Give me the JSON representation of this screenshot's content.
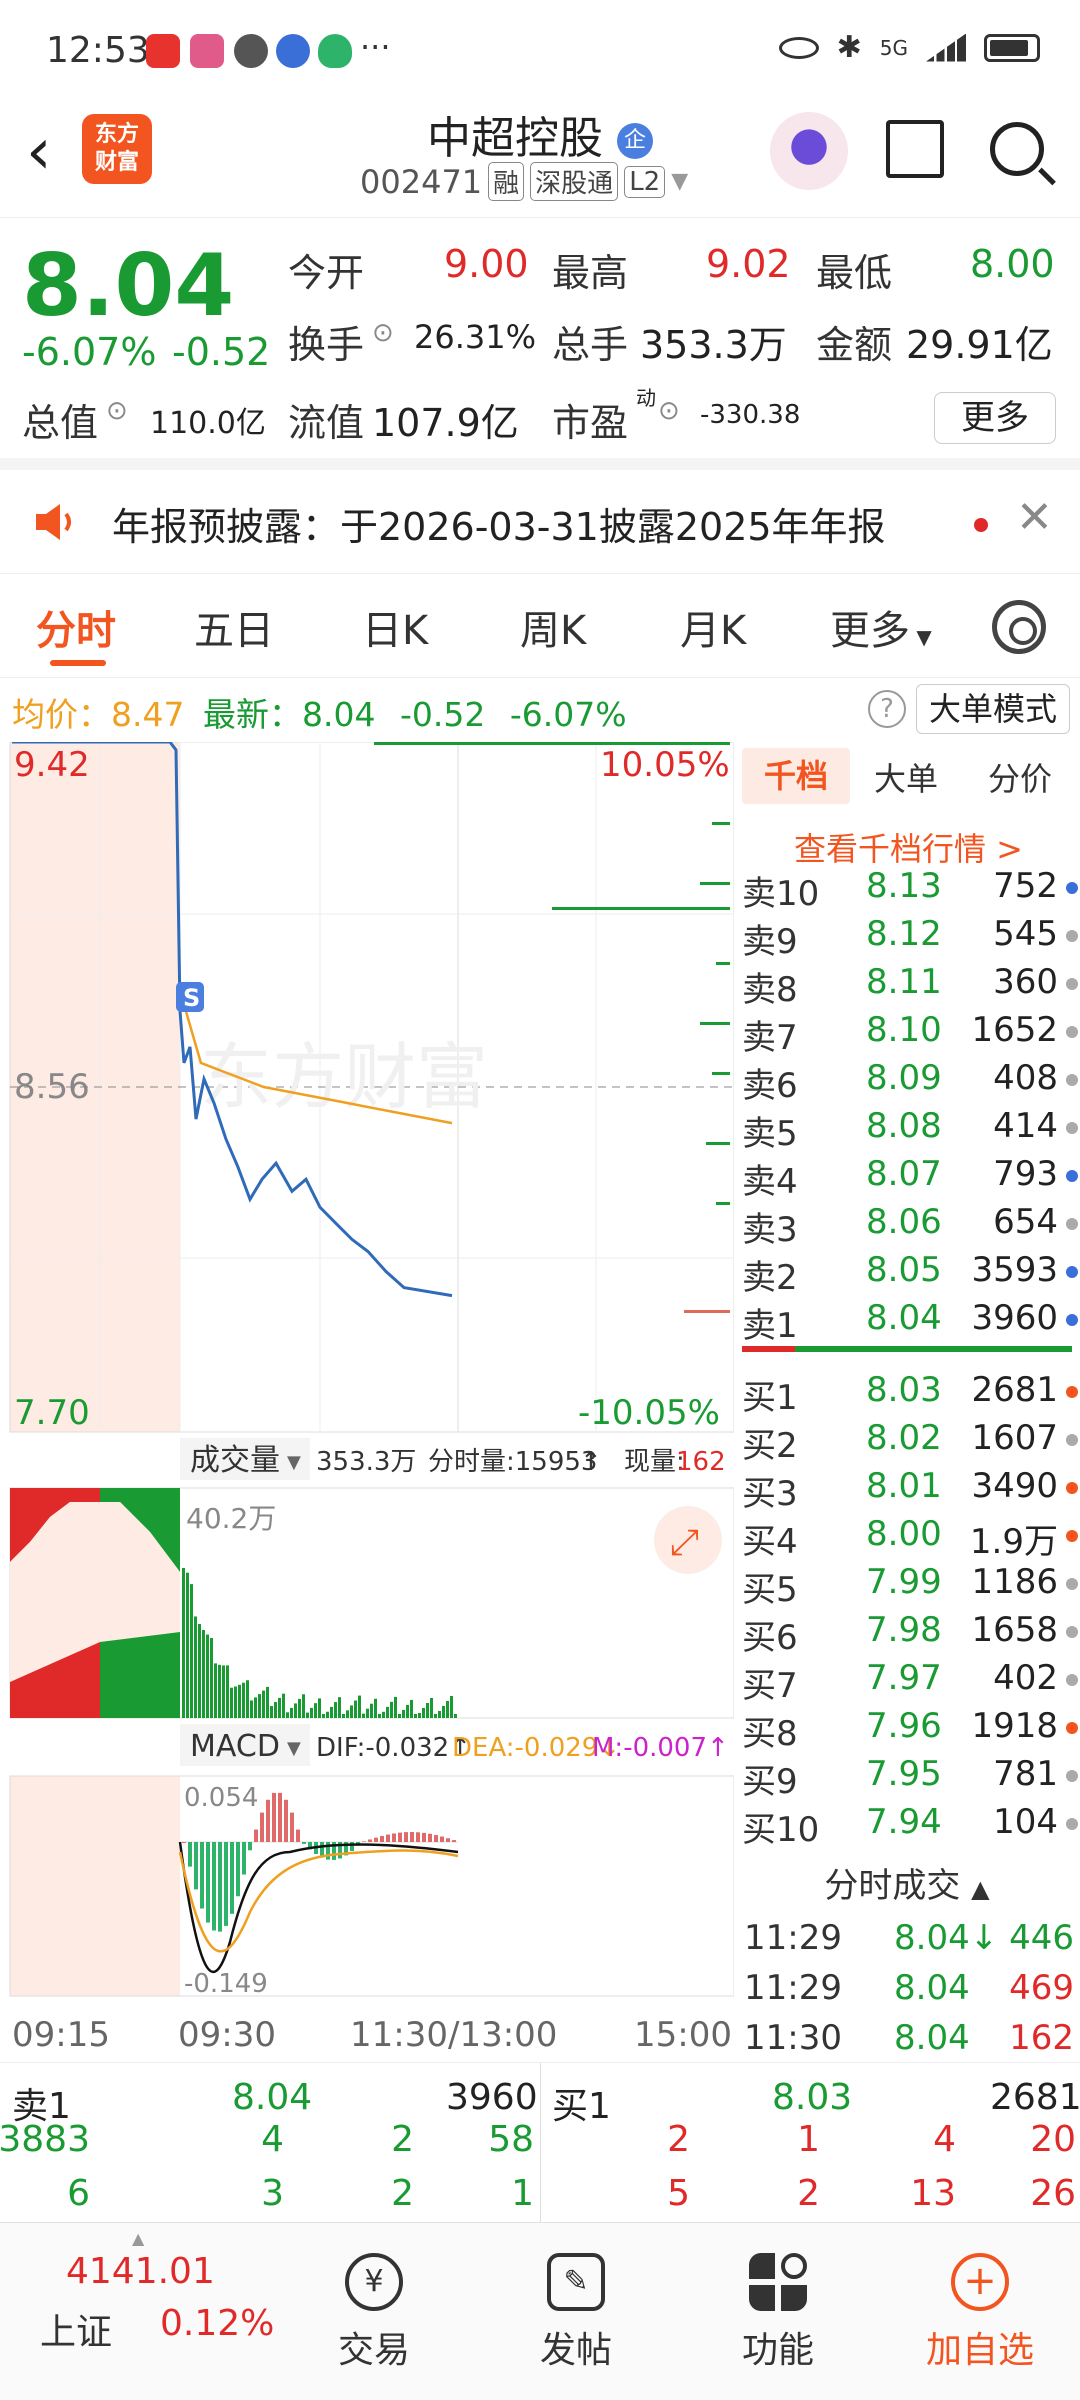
{
  "status_bar": {
    "time": "12:53",
    "network": "5G",
    "more": "···"
  },
  "header": {
    "title": "中超控股",
    "title_badge": "企",
    "code": "002471",
    "tags": [
      "融",
      "深股通",
      "L2"
    ],
    "logo_text_1": "东方",
    "logo_text_2": "财富"
  },
  "quote": {
    "price": "8.04",
    "change_pct": "-6.07%",
    "change": "-0.52",
    "open_label": "今开",
    "open": "9.00",
    "high_label": "最高",
    "high": "9.02",
    "low_label": "最低",
    "low": "8.00",
    "turnover_label": "换手",
    "turnover": "26.31%",
    "volume_label": "总手",
    "volume": "353.3万",
    "amount_label": "金额",
    "amount": "29.91亿",
    "mktcap_label": "总值",
    "mktcap": "110.0亿",
    "float_label": "流值",
    "float": "107.9亿",
    "pe_label": "市盈",
    "pe_sup": "动",
    "pe": "-330.38",
    "more_button": "更多"
  },
  "notice": {
    "text": "年报预披露：于2026-03-31披露2025年年报"
  },
  "tabs": [
    "分时",
    "五日",
    "日K",
    "周K",
    "月K",
    "更多"
  ],
  "avg_line": {
    "avg_label": "均价：",
    "avg": "8.47",
    "latest_label": "最新：",
    "latest": "8.04",
    "chg": "-0.52",
    "pct": "-6.07%",
    "help": "?",
    "mode_button": "大单模式"
  },
  "chart_labels": {
    "top_price": "9.42",
    "mid_price": "8.56",
    "bottom_price": "7.70",
    "top_pct": "10.05%",
    "bottom_pct": "-10.05%",
    "s_marker": "S",
    "watermark": "东方财富",
    "volume_panel": "成交量",
    "volume_total": "353.3万",
    "fen_label": "分时量:15953",
    "fen_arrow": "↑",
    "now_label": "现量:",
    "now_val": "162",
    "vol_max": "40.2万",
    "macd_panel": "MACD",
    "dif": "DIF:-0.032↑",
    "dea": "DEA:-0.029↓",
    "m": "M:-0.007↑",
    "macd_top": "0.054",
    "macd_bottom": "-0.149",
    "times": [
      "09:15",
      "09:30",
      "11:30/13:00",
      "15:00"
    ]
  },
  "chart_data": {
    "type": "line",
    "title": "",
    "ylim": [
      7.7,
      9.42
    ],
    "y_mid": 8.56,
    "x_ticks": [
      "09:15",
      "09:30",
      "11:30/13:00",
      "15:00"
    ],
    "series": [
      {
        "values": [
          9.42,
          9.42,
          9.42,
          9.4,
          8.75,
          8.62,
          8.66,
          8.48,
          8.58,
          8.52,
          8.43,
          8.36,
          8.28,
          8.33,
          8.37,
          8.3,
          8.33,
          8.26,
          8.22,
          8.18,
          8.15,
          8.1,
          8.06,
          8.04
        ]
      },
      {
        "values": [
          8.8,
          8.62,
          8.6,
          8.58,
          8.56,
          8.55,
          8.54,
          8.53,
          8.52,
          8.51,
          8.5,
          8.49,
          8.48,
          8.47
        ]
      }
    ]
  },
  "order_book": {
    "tabs": [
      "千档",
      "大单",
      "分价"
    ],
    "link": "查看千档行情 >",
    "asks": [
      {
        "name": "卖10",
        "price": "8.13",
        "vol": "752",
        "dot": "#3a6fd8"
      },
      {
        "name": "卖9",
        "price": "8.12",
        "vol": "545",
        "dot": "#aaaaaa"
      },
      {
        "name": "卖8",
        "price": "8.11",
        "vol": "360",
        "dot": "#aaaaaa"
      },
      {
        "name": "卖7",
        "price": "8.10",
        "vol": "1652",
        "dot": "#aaaaaa"
      },
      {
        "name": "卖6",
        "price": "8.09",
        "vol": "408",
        "dot": "#aaaaaa"
      },
      {
        "name": "卖5",
        "price": "8.08",
        "vol": "414",
        "dot": "#aaaaaa"
      },
      {
        "name": "卖4",
        "price": "8.07",
        "vol": "793",
        "dot": "#3a6fd8"
      },
      {
        "name": "卖3",
        "price": "8.06",
        "vol": "654",
        "dot": "#aaaaaa"
      },
      {
        "name": "卖2",
        "price": "8.05",
        "vol": "3593",
        "dot": "#3a6fd8"
      },
      {
        "name": "卖1",
        "price": "8.04",
        "vol": "3960",
        "dot": "#3a6fd8"
      }
    ],
    "bids": [
      {
        "name": "买1",
        "price": "8.03",
        "vol": "2681",
        "dot": "#f2551f"
      },
      {
        "name": "买2",
        "price": "8.02",
        "vol": "1607",
        "dot": "#aaaaaa"
      },
      {
        "name": "买3",
        "price": "8.01",
        "vol": "3490",
        "dot": "#f2551f"
      },
      {
        "name": "买4",
        "price": "8.00",
        "vol": "1.9万",
        "dot": "#f2551f"
      },
      {
        "name": "买5",
        "price": "7.99",
        "vol": "1186",
        "dot": "#aaaaaa"
      },
      {
        "name": "买6",
        "price": "7.98",
        "vol": "1658",
        "dot": "#aaaaaa"
      },
      {
        "name": "买7",
        "price": "7.97",
        "vol": "402",
        "dot": "#aaaaaa"
      },
      {
        "name": "买8",
        "price": "7.96",
        "vol": "1918",
        "dot": "#f2551f"
      },
      {
        "name": "买9",
        "price": "7.95",
        "vol": "781",
        "dot": "#aaaaaa"
      },
      {
        "name": "买10",
        "price": "7.94",
        "vol": "104",
        "dot": "#aaaaaa"
      }
    ],
    "trades_header": "分时成交",
    "trades": [
      {
        "time": "11:29",
        "price": "8.04↓",
        "vol": "446",
        "color": "#1a9a32"
      },
      {
        "time": "11:29",
        "price": "8.04",
        "vol": "469",
        "color": "#e02a2a"
      },
      {
        "time": "11:30",
        "price": "8.04",
        "vol": "162",
        "color": "#e02a2a"
      }
    ]
  },
  "summary": {
    "ask_label": "卖1",
    "ask_price": "8.04",
    "ask_vol": "3960",
    "bid_label": "买1",
    "bid_price": "8.03",
    "bid_vol": "2681",
    "ask_queue1": [
      "3883",
      "4",
      "2",
      "58"
    ],
    "ask_queue2": [
      "6",
      "3",
      "2",
      "1"
    ],
    "bid_queue1": [
      "2",
      "1",
      "4",
      "20"
    ],
    "bid_queue2": [
      "5",
      "2",
      "13",
      "26"
    ]
  },
  "bottom_nav": {
    "index_value": "4141.01",
    "index_name": "上证",
    "index_pct": "0.12%",
    "items": [
      "交易",
      "发帖",
      "功能",
      "加自选"
    ]
  }
}
